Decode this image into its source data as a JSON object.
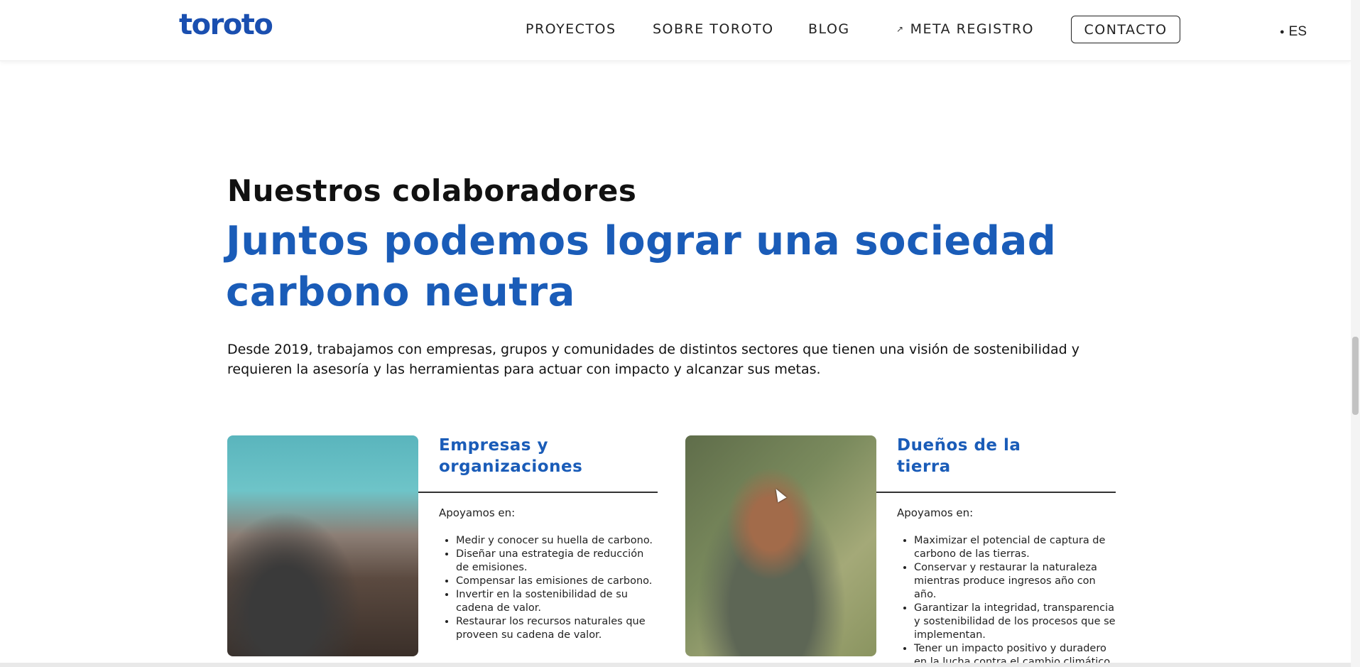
{
  "header": {
    "logo": "toroto",
    "nav": [
      {
        "label": "PROYECTOS"
      },
      {
        "label": "SOBRE TOROTO"
      },
      {
        "label": "BLOG"
      },
      {
        "label": "META REGISTRO",
        "icon": "external-link-icon"
      }
    ],
    "contact_label": "CONTACTO",
    "language": {
      "label": "ES",
      "icon": "chat-bubble-icon"
    }
  },
  "main": {
    "kicker": "Nuestros colaboradores",
    "title": "Juntos podemos lograr una sociedad carbono neutra",
    "description": "Desde 2019, trabajamos con empresas, grupos y comunidades de distintos sectores que tienen una visión de sostenibilidad y requieren la asesoría y las herramientas para actuar con impacto y alcanzar sus metas.",
    "cards": [
      {
        "title": "Empresas y organizaciones",
        "intro": "Apoyamos en:",
        "items": [
          "Medir y conocer su huella de carbono.",
          "Diseñar una estrategia de reducción de emisiones.",
          "Compensar las emisiones de carbono.",
          "Invertir en la sostenibilidad de su cadena de valor.",
          "Restaurar los recursos naturales que proveen su cadena de valor."
        ]
      },
      {
        "title": "Dueños de la tierra",
        "intro": "Apoyamos en:",
        "items": [
          "Maximizar el potencial de captura de carbono de las tierras.",
          "Conservar y restaurar la naturaleza mientras produce ingresos año con año.",
          "Garantizar la integridad, transparencia y sostenibilidad de los procesos que se implementan.",
          "Tener un impacto positivo y duradero en la lucha contra el cambio climático."
        ]
      }
    ]
  },
  "colors": {
    "brand_blue": "#1a5cb8",
    "logo_blue": "#1a4fb0"
  }
}
